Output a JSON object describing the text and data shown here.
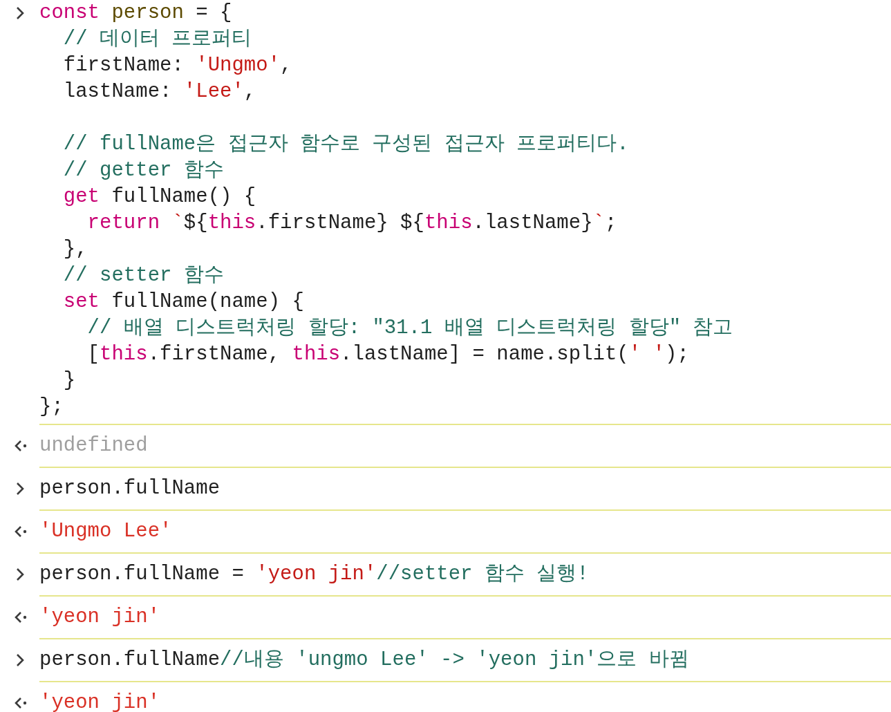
{
  "console": {
    "entries": [
      {
        "kind": "input",
        "lines": [
          {
            "kind": "code",
            "tokens": [
              {
                "kind": "keyword",
                "text": "const"
              },
              {
                "kind": "variable",
                "text": " person"
              },
              {
                "kind": "plain",
                "text": " = {"
              }
            ]
          },
          {
            "kind": "code",
            "tokens": [
              {
                "kind": "comment",
                "text": "  // 데이터 프로퍼티"
              }
            ]
          },
          {
            "kind": "code",
            "tokens": [
              {
                "kind": "plain",
                "text": "  firstName: "
              },
              {
                "kind": "string",
                "text": "'Ungmo'"
              },
              {
                "kind": "plain",
                "text": ","
              }
            ]
          },
          {
            "kind": "code",
            "tokens": [
              {
                "kind": "plain",
                "text": "  lastName: "
              },
              {
                "kind": "string",
                "text": "'Lee'"
              },
              {
                "kind": "plain",
                "text": ","
              }
            ]
          },
          {
            "kind": "blank"
          },
          {
            "kind": "code",
            "tokens": [
              {
                "kind": "comment",
                "text": "  // fullName은 접근자 함수로 구성된 접근자 프로퍼티다."
              }
            ]
          },
          {
            "kind": "code",
            "tokens": [
              {
                "kind": "comment",
                "text": "  // getter 함수"
              }
            ]
          },
          {
            "kind": "code",
            "tokens": [
              {
                "kind": "keyword",
                "text": "  get"
              },
              {
                "kind": "plain",
                "text": " fullName() {"
              }
            ]
          },
          {
            "kind": "code",
            "tokens": [
              {
                "kind": "keyword",
                "text": "    return"
              },
              {
                "kind": "string",
                "text": " `"
              },
              {
                "kind": "plain",
                "text": "${"
              },
              {
                "kind": "keyword",
                "text": "this"
              },
              {
                "kind": "plain",
                "text": ".firstName} ${"
              },
              {
                "kind": "keyword",
                "text": "this"
              },
              {
                "kind": "plain",
                "text": ".lastName}"
              },
              {
                "kind": "string",
                "text": "`"
              },
              {
                "kind": "plain",
                "text": ";"
              }
            ]
          },
          {
            "kind": "code",
            "tokens": [
              {
                "kind": "plain",
                "text": "  },"
              }
            ]
          },
          {
            "kind": "code",
            "tokens": [
              {
                "kind": "comment",
                "text": "  // setter 함수"
              }
            ]
          },
          {
            "kind": "code",
            "tokens": [
              {
                "kind": "keyword",
                "text": "  set"
              },
              {
                "kind": "plain",
                "text": " fullName(name) {"
              }
            ]
          },
          {
            "kind": "code",
            "tokens": [
              {
                "kind": "comment",
                "text": "    // 배열 디스트럭처링 할당: \"31.1 배열 디스트럭처링 할당\" 참고"
              }
            ]
          },
          {
            "kind": "code",
            "tokens": [
              {
                "kind": "plain",
                "text": "    ["
              },
              {
                "kind": "keyword",
                "text": "this"
              },
              {
                "kind": "plain",
                "text": ".firstName, "
              },
              {
                "kind": "keyword",
                "text": "this"
              },
              {
                "kind": "plain",
                "text": ".lastName] = name.split("
              },
              {
                "kind": "string",
                "text": "' '"
              },
              {
                "kind": "plain",
                "text": ");"
              }
            ]
          },
          {
            "kind": "code",
            "tokens": [
              {
                "kind": "plain",
                "text": "  }"
              }
            ]
          },
          {
            "kind": "code",
            "tokens": [
              {
                "kind": "plain",
                "text": "};"
              }
            ]
          }
        ]
      },
      {
        "kind": "output",
        "lines": [
          {
            "kind": "code",
            "tokens": [
              {
                "kind": "undefined",
                "text": "undefined"
              }
            ]
          }
        ]
      },
      {
        "kind": "input",
        "lines": [
          {
            "kind": "code",
            "tokens": [
              {
                "kind": "plain",
                "text": "person.fullName"
              }
            ]
          }
        ]
      },
      {
        "kind": "output",
        "lines": [
          {
            "kind": "code",
            "tokens": [
              {
                "kind": "result",
                "text": "'Ungmo Lee'"
              }
            ]
          }
        ]
      },
      {
        "kind": "input",
        "lines": [
          {
            "kind": "code",
            "tokens": [
              {
                "kind": "plain",
                "text": "person.fullName = "
              },
              {
                "kind": "string",
                "text": "'yeon jin'"
              },
              {
                "kind": "comment",
                "text": "//setter 함수 실행!"
              }
            ]
          }
        ]
      },
      {
        "kind": "output",
        "lines": [
          {
            "kind": "code",
            "tokens": [
              {
                "kind": "result",
                "text": "'yeon jin'"
              }
            ]
          }
        ]
      },
      {
        "kind": "input",
        "lines": [
          {
            "kind": "code",
            "tokens": [
              {
                "kind": "plain",
                "text": "person.fullName"
              },
              {
                "kind": "comment",
                "text": "//내용 'ungmo Lee' -> 'yeon jin'으로 바뀜"
              }
            ]
          }
        ]
      },
      {
        "kind": "output",
        "lines": [
          {
            "kind": "code",
            "tokens": [
              {
                "kind": "result",
                "text": "'yeon jin'"
              }
            ]
          }
        ]
      }
    ]
  }
}
